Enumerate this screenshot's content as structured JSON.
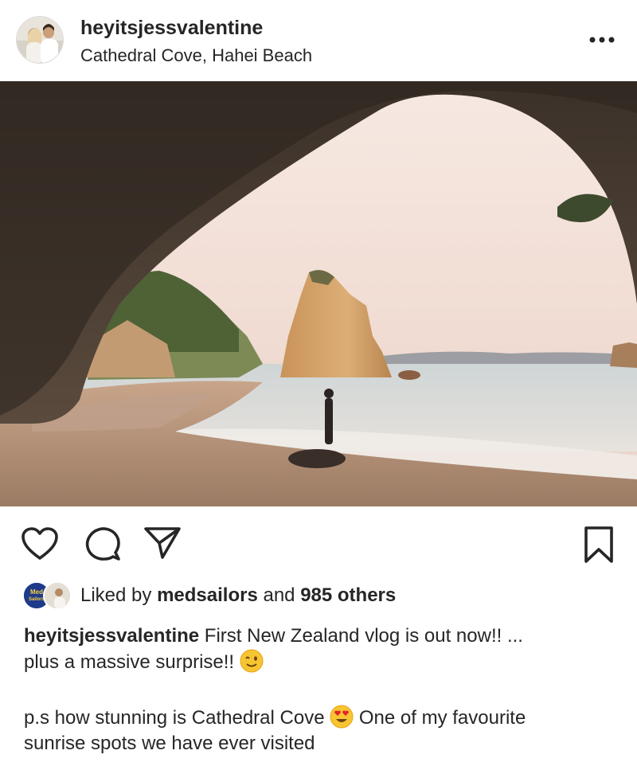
{
  "post": {
    "username": "heyitsjessvalentine",
    "location": "Cathedral Cove, Hahei Beach"
  },
  "icons": {
    "more": "more-options-icon",
    "like": "heart-icon",
    "comment": "comment-icon",
    "share": "paper-plane-icon",
    "save": "bookmark-icon"
  },
  "likes": {
    "prefix": "Liked by",
    "user": "medsailors",
    "conjunction": "and",
    "others": "985 others",
    "avatar_label": "Med Sailors"
  },
  "caption": {
    "username": "heyitsjessvalentine",
    "line1": "First New Zealand vlog is out now!! ...",
    "line2": "plus a massive surprise!!",
    "line2_emoji": "winking-face",
    "line3a": "p.s how stunning is Cathedral Cove",
    "line3_emoji": "heart-eyes-face",
    "line3b": "One of my favourite",
    "line4": "sunrise spots we have ever visited"
  },
  "colors": {
    "text": "#262626",
    "divider": "#dbdbdb",
    "medsailors_badge": "#1f3a8a"
  }
}
